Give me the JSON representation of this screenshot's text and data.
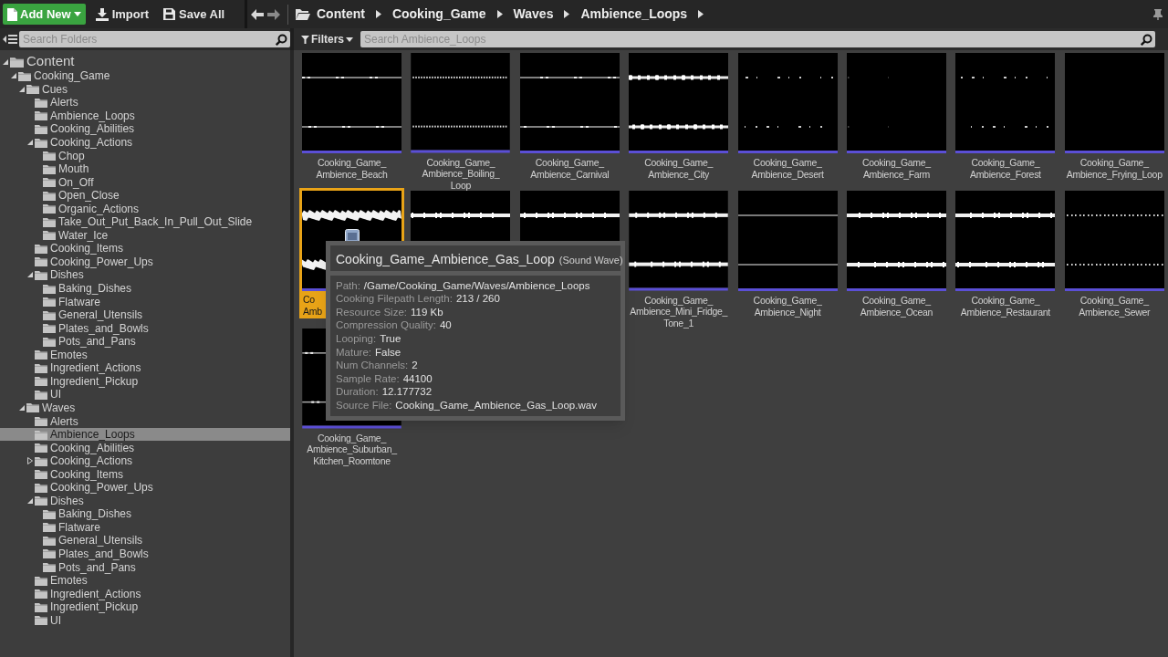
{
  "toolbar": {
    "buttons": [
      {
        "label": "Add New",
        "kind": "primary"
      },
      {
        "label": "Import",
        "kind": "import"
      },
      {
        "label": "Save All",
        "kind": "save"
      }
    ]
  },
  "breadcrumbs": [
    "Content",
    "Cooking_Game",
    "Waves",
    "Ambience_Loops"
  ],
  "folder_search": {
    "placeholder": "Search Folders"
  },
  "filters": {
    "label": "Filters"
  },
  "asset_search": {
    "placeholder": "Search Ambience_Loops"
  },
  "tree": [
    {
      "label": "Content",
      "expanded": true,
      "selected": false,
      "children": [
        {
          "label": "Cooking_Game",
          "expanded": true,
          "selected": false,
          "children": [
            {
              "label": "Cues",
              "expanded": true,
              "selected": false,
              "children": [
                {
                  "label": "Alerts",
                  "selected": false
                },
                {
                  "label": "Ambience_Loops",
                  "selected": false
                },
                {
                  "label": "Cooking_Abilities",
                  "selected": false
                },
                {
                  "label": "Cooking_Actions",
                  "expanded": true,
                  "selected": false,
                  "children": [
                    {
                      "label": "Chop",
                      "selected": false
                    },
                    {
                      "label": "Mouth",
                      "selected": false
                    },
                    {
                      "label": "On_Off",
                      "selected": false
                    },
                    {
                      "label": "Open_Close",
                      "selected": false
                    },
                    {
                      "label": "Organic_Actions",
                      "selected": false
                    },
                    {
                      "label": "Take_Out_Put_Back_In_Pull_Out_Slide",
                      "selected": false
                    },
                    {
                      "label": "Water_Ice",
                      "selected": false
                    }
                  ]
                },
                {
                  "label": "Cooking_Items",
                  "selected": false
                },
                {
                  "label": "Cooking_Power_Ups",
                  "selected": false
                },
                {
                  "label": "Dishes",
                  "expanded": true,
                  "selected": false,
                  "children": [
                    {
                      "label": "Baking_Dishes",
                      "selected": false
                    },
                    {
                      "label": "Flatware",
                      "selected": false
                    },
                    {
                      "label": "General_Utensils",
                      "selected": false
                    },
                    {
                      "label": "Plates_and_Bowls",
                      "selected": false
                    },
                    {
                      "label": "Pots_and_Pans",
                      "selected": false
                    }
                  ]
                },
                {
                  "label": "Emotes",
                  "selected": false
                },
                {
                  "label": "Ingredient_Actions",
                  "selected": false
                },
                {
                  "label": "Ingredient_Pickup",
                  "selected": false
                },
                {
                  "label": "UI",
                  "selected": false
                }
              ]
            },
            {
              "label": "Waves",
              "expanded": true,
              "selected": false,
              "children": [
                {
                  "label": "Alerts",
                  "selected": false
                },
                {
                  "label": "Ambience_Loops",
                  "selected": true
                },
                {
                  "label": "Cooking_Abilities",
                  "selected": false
                },
                {
                  "label": "Cooking_Actions",
                  "expanded": false,
                  "selected": false
                },
                {
                  "label": "Cooking_Items",
                  "selected": false
                },
                {
                  "label": "Cooking_Power_Ups",
                  "selected": false
                },
                {
                  "label": "Dishes",
                  "expanded": true,
                  "selected": false,
                  "children": [
                    {
                      "label": "Baking_Dishes",
                      "selected": false
                    },
                    {
                      "label": "Flatware",
                      "selected": false
                    },
                    {
                      "label": "General_Utensils",
                      "selected": false
                    },
                    {
                      "label": "Plates_and_Bowls",
                      "selected": false
                    },
                    {
                      "label": "Pots_and_Pans",
                      "selected": false
                    }
                  ]
                },
                {
                  "label": "Emotes",
                  "selected": false
                },
                {
                  "label": "Ingredient_Actions",
                  "selected": false
                },
                {
                  "label": "Ingredient_Pickup",
                  "selected": false
                },
                {
                  "label": "UI",
                  "selected": false
                }
              ]
            }
          ]
        }
      ]
    }
  ],
  "assets": [
    {
      "label_lines": [
        "Cooking_Game_",
        "Ambience_Beach"
      ],
      "kind": "thin",
      "selected": false
    },
    {
      "label_lines": [
        "Cooking_Game_",
        "Ambience_Boiling_",
        "Loop"
      ],
      "kind": "dotted",
      "selected": false
    },
    {
      "label_lines": [
        "Cooking_Game_",
        "Ambience_Carnival"
      ],
      "kind": "thin",
      "selected": false
    },
    {
      "label_lines": [
        "Cooking_Game_",
        "Ambience_City"
      ],
      "kind": "thick",
      "selected": false
    },
    {
      "label_lines": [
        "Cooking_Game_",
        "Ambience_Desert"
      ],
      "kind": "sparse",
      "selected": false
    },
    {
      "label_lines": [
        "Cooking_Game_",
        "Ambience_Farm"
      ],
      "kind": "faint",
      "selected": false
    },
    {
      "label_lines": [
        "Cooking_Game_",
        "Ambience_Forest"
      ],
      "kind": "sparse",
      "selected": false
    },
    {
      "label_lines": [
        "Cooking_Game_",
        "Ambience_Frying_Loop"
      ],
      "kind": "empty",
      "selected": false
    },
    {
      "label_lines": [
        "Co",
        "Amb"
      ],
      "kind": "dense",
      "selected": true
    },
    {
      "kind": "medium",
      "selected": false
    },
    {
      "kind": "medium",
      "selected": false
    },
    {
      "label_lines": [
        "Cooking_Game_",
        "Ambience_Mini_Fridge_",
        "Tone_1"
      ],
      "kind": "medium",
      "selected": false
    },
    {
      "label_lines": [
        "Cooking_Game_",
        "Ambience_Night"
      ],
      "kind": "line",
      "selected": false
    },
    {
      "label_lines": [
        "Cooking_Game_",
        "Ambience_Ocean"
      ],
      "kind": "medium",
      "selected": false
    },
    {
      "label_lines": [
        "Cooking_Game_",
        "Ambience_Restaurant"
      ],
      "kind": "medium",
      "selected": false
    },
    {
      "label_lines": [
        "Cooking_Game_",
        "Ambience_Sewer"
      ],
      "kind": "dotted",
      "selected": false
    },
    {
      "label_lines": [
        "Cooking_Game_",
        "Ambience_Suburban_",
        "Kitchen_Roomtone"
      ],
      "kind": "thin",
      "selected": false
    }
  ],
  "tooltip": {
    "title": "Cooking_Game_Ambience_Gas_Loop",
    "type": "(Sound Wave)",
    "properties": [
      {
        "key": "Path:",
        "value": "/Game/Cooking_Game/Waves/Ambience_Loops"
      },
      {
        "key": "Cooking Filepath Length:",
        "value": "213 / 260"
      },
      {
        "key": "Resource Size:",
        "value": "119 Kb"
      },
      {
        "key": "Compression Quality:",
        "value": "40"
      },
      {
        "key": "Looping:",
        "value": "True"
      },
      {
        "key": "Mature:",
        "value": "False"
      },
      {
        "key": "Num Channels:",
        "value": "2"
      },
      {
        "key": "Sample Rate:",
        "value": "44100"
      },
      {
        "key": "Duration:",
        "value": "12.177732"
      },
      {
        "key": "Source File:",
        "value": "Cooking_Game_Ambience_Gas_Loop.wav"
      }
    ]
  }
}
